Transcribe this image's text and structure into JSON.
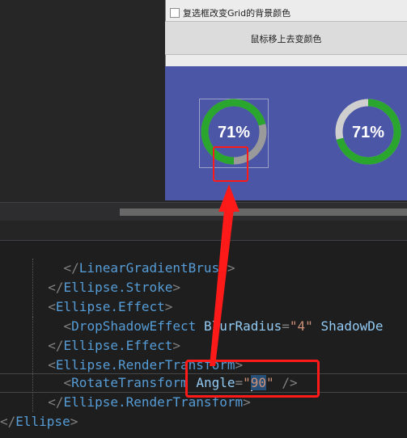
{
  "designer": {
    "checkbox_label": "复选框改变Grid的背景颜色",
    "hover_button_label": "鼠标移上去变颜色",
    "progress_rings": [
      {
        "label": "71%",
        "value": 0.71
      },
      {
        "label": "71%",
        "value": 0.71
      }
    ]
  },
  "code": {
    "lines": [
      {
        "indent": "    ",
        "parts": [
          [
            "p",
            "</"
          ],
          [
            "t",
            "LinearGradientBrush"
          ],
          [
            "p",
            ">"
          ]
        ]
      },
      {
        "indent": "  ",
        "parts": [
          [
            "p",
            "</"
          ],
          [
            "t",
            "Ellipse.Stroke"
          ],
          [
            "p",
            ">"
          ]
        ]
      },
      {
        "indent": "  ",
        "parts": [
          [
            "p",
            "<"
          ],
          [
            "t",
            "Ellipse.Effect"
          ],
          [
            "p",
            ">"
          ]
        ]
      },
      {
        "indent": "    ",
        "parts": [
          [
            "p",
            "<"
          ],
          [
            "t",
            "DropShadowEffect"
          ],
          [
            "w",
            " "
          ],
          [
            "a",
            "BlurRadius"
          ],
          [
            "p",
            "="
          ],
          [
            "v",
            "\"4\""
          ],
          [
            "w",
            " "
          ],
          [
            "a",
            "ShadowDe"
          ]
        ]
      },
      {
        "indent": "  ",
        "parts": [
          [
            "p",
            "</"
          ],
          [
            "t",
            "Ellipse.Effect"
          ],
          [
            "p",
            ">"
          ]
        ]
      },
      {
        "indent": "  ",
        "parts": [
          [
            "p",
            "<"
          ],
          [
            "t",
            "Ellipse.RenderTransform"
          ],
          [
            "p",
            ">"
          ]
        ]
      },
      {
        "indent": "    ",
        "parts": [
          [
            "p",
            "<"
          ],
          [
            "t",
            "RotateTransform"
          ],
          [
            "w",
            " "
          ],
          [
            "a",
            "Angle"
          ],
          [
            "p",
            "="
          ],
          [
            "v",
            "\""
          ],
          [
            "sel",
            "90"
          ],
          [
            "v",
            "\""
          ],
          [
            "w",
            " "
          ],
          [
            "p",
            "/>"
          ]
        ]
      },
      {
        "indent": "  ",
        "parts": [
          [
            "p",
            "</"
          ],
          [
            "t",
            "Ellipse.RenderTransform"
          ],
          [
            "p",
            ">"
          ]
        ]
      },
      {
        "indent": "",
        "parts": [
          [
            "p",
            "</"
          ],
          [
            "t",
            "Ellipse"
          ],
          [
            "p",
            ">"
          ]
        ]
      }
    ]
  },
  "colors": {
    "annotation": "#ff1a1a",
    "panel": "#4b56a6",
    "ring_green": "#2aa52e",
    "ring_gray": "#9a9a9a"
  }
}
